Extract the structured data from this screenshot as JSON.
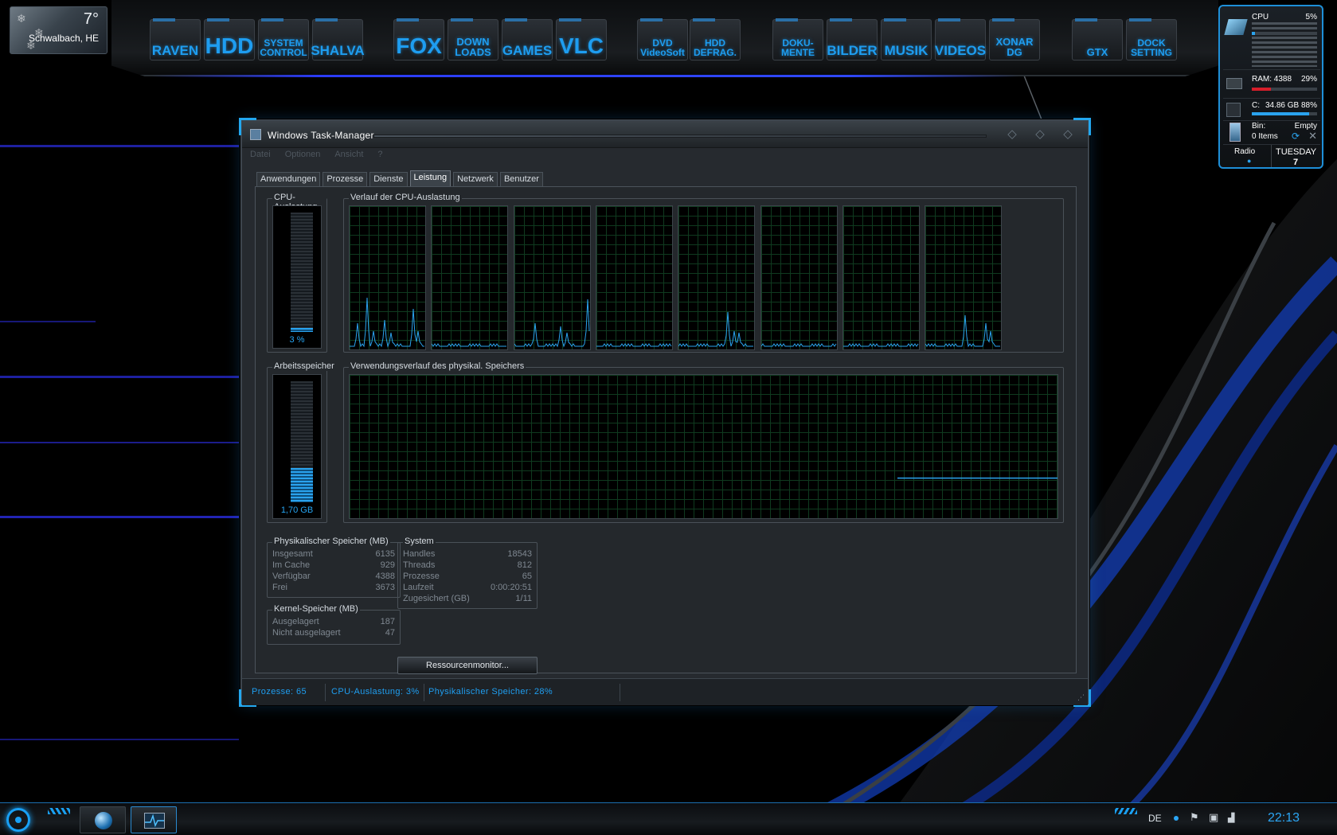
{
  "weather": {
    "temperature": "7°",
    "location": "Schwalbach, HE"
  },
  "dock": {
    "items": [
      {
        "label": "RAVEN",
        "size": "med"
      },
      {
        "label": "HDD",
        "size": "big"
      },
      {
        "label": "SYSTEM\nCONTROL",
        "size": "tiny"
      },
      {
        "label": "SHALVA",
        "size": "med"
      },
      {
        "label": "FOX",
        "size": "big"
      },
      {
        "label": "DOWN\nLOADS",
        "size": "small"
      },
      {
        "label": "GAMES",
        "size": "med"
      },
      {
        "label": "VLC",
        "size": "big"
      },
      {
        "label": "DVD\nVideoSoft",
        "size": "tiny"
      },
      {
        "label": "HDD\nDEFRAG.",
        "size": "tiny"
      },
      {
        "label": "DOKU-\nMENTE",
        "size": "tiny"
      },
      {
        "label": "BILDER",
        "size": "med"
      },
      {
        "label": "MUSIK",
        "size": "med"
      },
      {
        "label": "VIDEOS",
        "size": "med"
      },
      {
        "label": "XONAR\nDG",
        "size": "small"
      },
      {
        "label": "GTX",
        "size": "small"
      },
      {
        "label": "DOCK\nSETTING",
        "size": "tiny"
      }
    ]
  },
  "sidebar": {
    "cpu_label": "CPU",
    "cpu_value": "5%",
    "cpu_fraction": 0.05,
    "ram_label": "RAM: 4388",
    "ram_value": "29%",
    "ram_fraction": 0.29,
    "disk_label": "C:",
    "disk_value": "34.86 GB 88%",
    "disk_fraction": 0.88,
    "bin_label": "Bin:",
    "bin_status": "Empty",
    "bin_items": "0 Items",
    "radio_label": "Radio",
    "day": "TUESDAY",
    "date": "7",
    "accent_color": "#1e8fd8"
  },
  "window": {
    "title": "Windows Task-Manager",
    "menu": [
      "Datei",
      "Optionen",
      "Ansicht",
      "?"
    ],
    "tabs": [
      {
        "label": "Anwendungen",
        "active": false
      },
      {
        "label": "Prozesse",
        "active": false
      },
      {
        "label": "Dienste",
        "active": false
      },
      {
        "label": "Leistung",
        "active": true
      },
      {
        "label": "Netzwerk",
        "active": false
      },
      {
        "label": "Benutzer",
        "active": false
      }
    ],
    "cpu_usage": {
      "label": "CPU-Auslastung",
      "value": "3 %",
      "fraction": 0.03
    },
    "cpu_history": {
      "label": "Verlauf der CPU-Auslastung",
      "cores": 8
    },
    "memory": {
      "label": "Arbeitsspeicher",
      "value": "1,70 GB",
      "fraction": 0.28
    },
    "memory_history": {
      "label": "Verwendungsverlauf des physikal. Speichers"
    },
    "physical_memory": {
      "label": "Physikalischer Speicher (MB)",
      "rows": [
        {
          "key": "Insgesamt",
          "value": "6135"
        },
        {
          "key": "Im Cache",
          "value": "929"
        },
        {
          "key": "Verfügbar",
          "value": "4388"
        },
        {
          "key": "Frei",
          "value": "3673"
        }
      ]
    },
    "kernel_memory": {
      "label": "Kernel-Speicher (MB)",
      "rows": [
        {
          "key": "Ausgelagert",
          "value": "187"
        },
        {
          "key": "Nicht ausgelagert",
          "value": "47"
        }
      ]
    },
    "system": {
      "label": "System",
      "rows": [
        {
          "key": "Handles",
          "value": "18543"
        },
        {
          "key": "Threads",
          "value": "812"
        },
        {
          "key": "Prozesse",
          "value": "65"
        },
        {
          "key": "Laufzeit",
          "value": "0:00:20:51"
        },
        {
          "key": "Zugesichert (GB)",
          "value": "1/11"
        }
      ]
    },
    "resource_monitor_button": "Ressourcenmonitor...",
    "status": {
      "processes": "Prozesse: 65",
      "cpu": "CPU-Auslastung: 3%",
      "memory": "Physikalischer Speicher: 28%"
    }
  },
  "taskbar": {
    "language": "DE",
    "clock": "22:13"
  },
  "colors": {
    "accent": "#1f9ef0",
    "graph_line": "#2aa3ee",
    "graph_grid": "#0f3a1f"
  }
}
